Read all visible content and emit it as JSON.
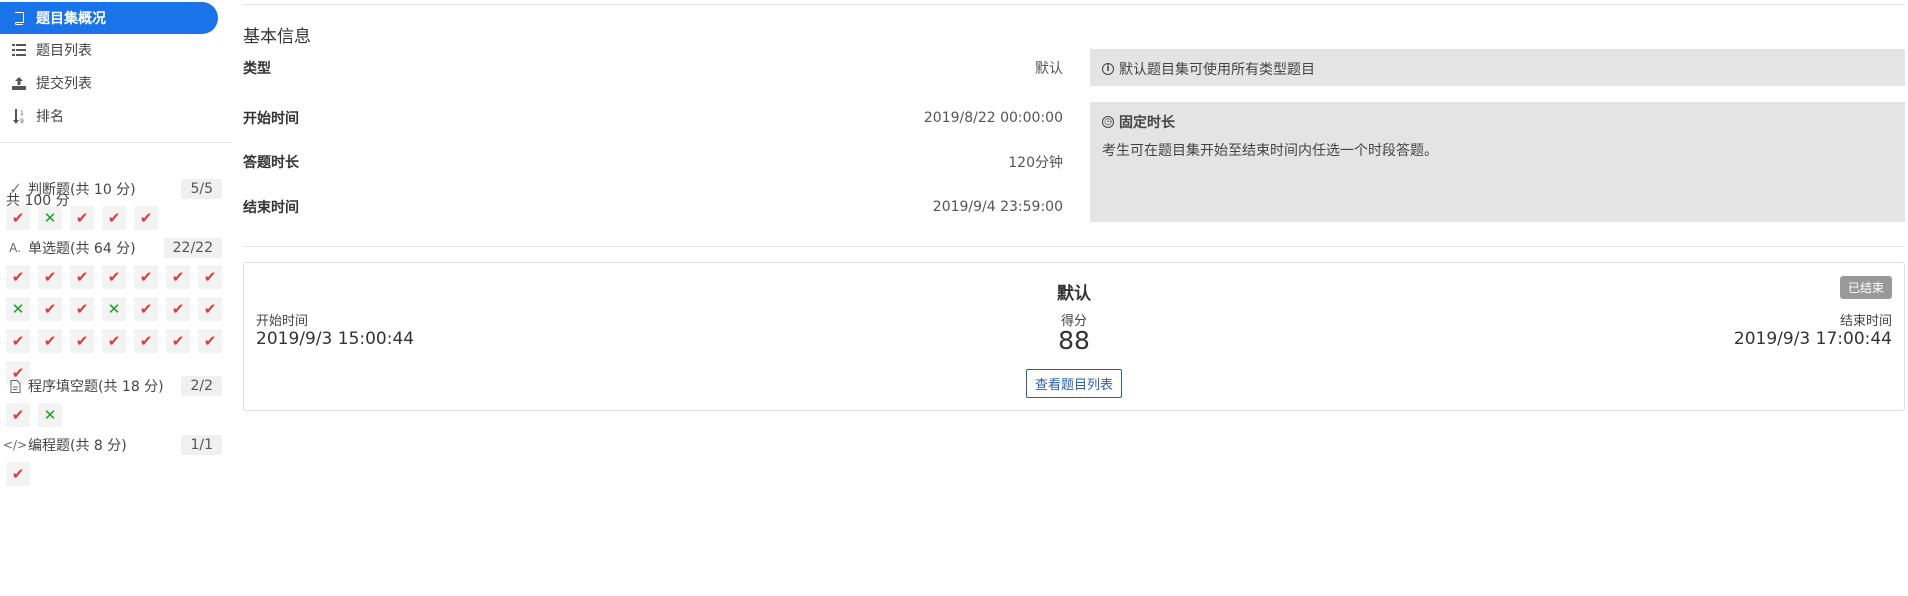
{
  "sidebar": {
    "nav": [
      {
        "label": "题目集概况",
        "icon": "book-icon",
        "active": true
      },
      {
        "label": "题目列表",
        "icon": "list-icon",
        "active": false
      },
      {
        "label": "提交列表",
        "icon": "upload-icon",
        "active": false
      },
      {
        "label": "排名",
        "icon": "sort-numeric-icon",
        "active": false
      }
    ],
    "total": "共 100 分",
    "sections": [
      {
        "icon": "true-false-icon",
        "title": "判断题(共 10 分)",
        "ratio": "5/5",
        "results": [
          "ok",
          "bad",
          "ok",
          "ok",
          "ok"
        ]
      },
      {
        "icon": "single-choice-icon",
        "title": "单选题(共 64 分)",
        "ratio": "22/22",
        "results": [
          "ok",
          "ok",
          "ok",
          "ok",
          "ok",
          "ok",
          "ok",
          "bad",
          "ok",
          "ok",
          "bad",
          "ok",
          "ok",
          "ok",
          "ok",
          "ok",
          "ok",
          "ok",
          "ok",
          "ok",
          "ok",
          "ok"
        ]
      },
      {
        "icon": "fill-blank-icon",
        "title": "程序填空题(共 18 分)",
        "ratio": "2/2",
        "results": [
          "ok",
          "bad"
        ]
      },
      {
        "icon": "code-icon",
        "title": "编程题(共 8 分)",
        "ratio": "1/1",
        "results": [
          "ok"
        ]
      }
    ]
  },
  "main": {
    "section_title": "基本信息",
    "info": {
      "type_label": "类型",
      "type_value": "默认",
      "start_label": "开始时间",
      "start_value": "2019/8/22 00:00:00",
      "duration_label": "答题时长",
      "duration_value": "120分钟",
      "end_label": "结束时间",
      "end_value": "2019/9/4 23:59:00"
    },
    "tip_default": "默认题目集可使用所有类型题目",
    "tip_fixed_title": "固定时长",
    "tip_fixed_text": "考生可在题目集开始至结束时间内任选一个时段答题。",
    "card": {
      "title": "默认",
      "status": "已结束",
      "start_label": "开始时间",
      "start_value": "2019/9/3 15:00:44",
      "score_label": "得分",
      "score": "88",
      "end_label": "结束时间",
      "end_value": "2019/9/3 17:00:44",
      "button": "查看题目列表"
    }
  },
  "colors": {
    "accent": "#1a73e8",
    "correct": "#e03a3a",
    "wrong": "#17a31a",
    "tip_bg": "#e4e4e4"
  }
}
